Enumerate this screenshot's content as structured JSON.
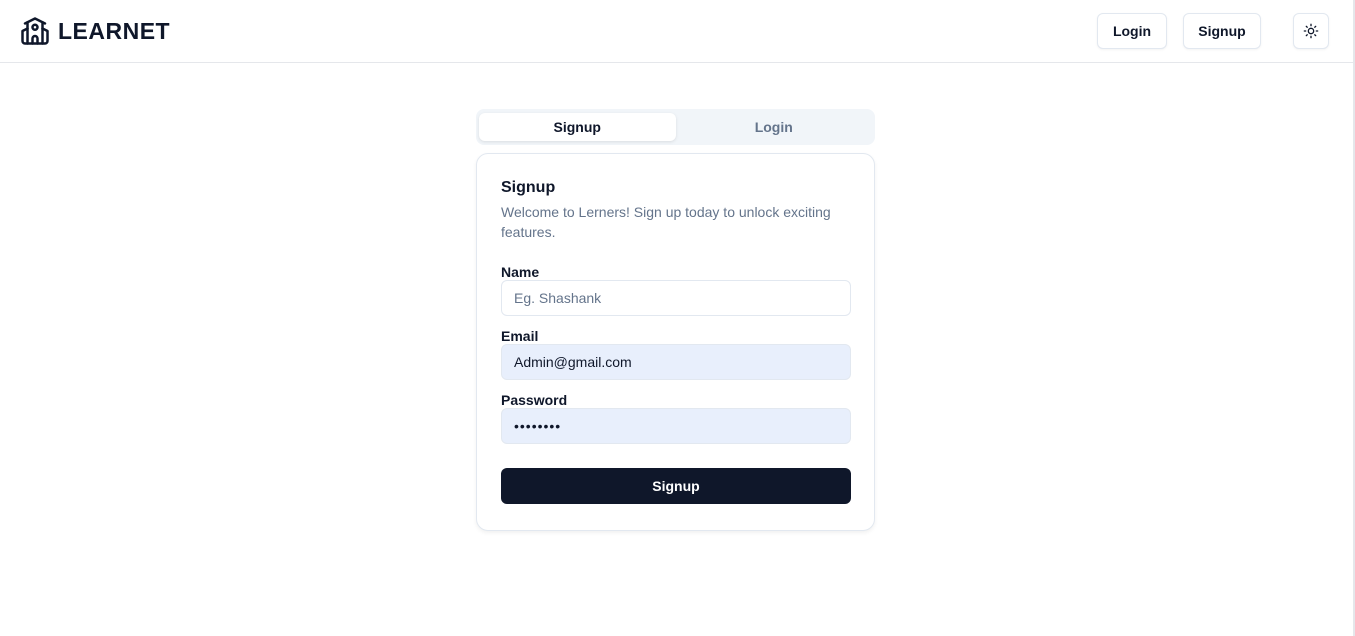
{
  "header": {
    "brand": "LEARNET",
    "login_label": "Login",
    "signup_label": "Signup",
    "theme_icon": "sun-icon"
  },
  "tabs": [
    {
      "label": "Signup",
      "active": true
    },
    {
      "label": "Login",
      "active": false
    }
  ],
  "card": {
    "title": "Signup",
    "description": "Welcome to Lerners! Sign up today to unlock exciting features.",
    "fields": {
      "name": {
        "label": "Name",
        "value": "",
        "placeholder": "Eg. Shashank"
      },
      "email": {
        "label": "Email",
        "value": "Admin@gmail.com"
      },
      "password": {
        "label": "Password",
        "value": "••••••••"
      }
    },
    "submit_label": "Signup"
  },
  "colors": {
    "primary": "#0f172a",
    "muted": "#64748b",
    "autofill_bg": "#e8effc",
    "border": "#e2e8f0"
  }
}
